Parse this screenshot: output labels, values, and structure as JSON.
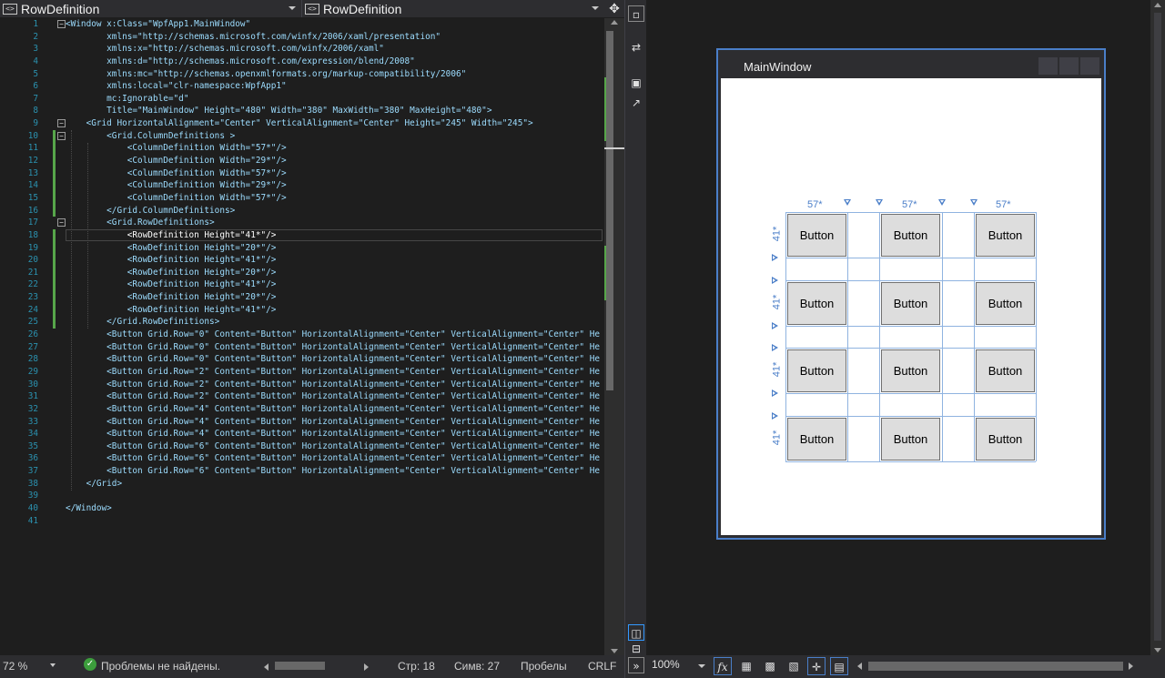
{
  "nav": {
    "left_combo": "RowDefinition",
    "right_combo": "RowDefinition",
    "split_icon": "split-vertical-icon"
  },
  "code_lines": [
    {
      "n": "1",
      "text": "<Window x:Class=\"WpfApp1.MainWindow\""
    },
    {
      "n": "2",
      "text": "        xmlns=\"http://schemas.microsoft.com/winfx/2006/xaml/presentation\""
    },
    {
      "n": "3",
      "text": "        xmlns:x=\"http://schemas.microsoft.com/winfx/2006/xaml\""
    },
    {
      "n": "4",
      "text": "        xmlns:d=\"http://schemas.microsoft.com/expression/blend/2008\""
    },
    {
      "n": "5",
      "text": "        xmlns:mc=\"http://schemas.openxmlformats.org/markup-compatibility/2006\""
    },
    {
      "n": "6",
      "text": "        xmlns:local=\"clr-namespace:WpfApp1\""
    },
    {
      "n": "7",
      "text": "        mc:Ignorable=\"d\""
    },
    {
      "n": "8",
      "text": "        Title=\"MainWindow\" Height=\"480\" Width=\"380\" MaxWidth=\"380\" MaxHeight=\"480\">"
    },
    {
      "n": "9",
      "text": "    <Grid HorizontalAlignment=\"Center\" VerticalAlignment=\"Center\" Height=\"245\" Width=\"245\">"
    },
    {
      "n": "10",
      "text": "        <Grid.ColumnDefinitions >"
    },
    {
      "n": "11",
      "text": "            <ColumnDefinition Width=\"57*\"/>"
    },
    {
      "n": "12",
      "text": "            <ColumnDefinition Width=\"29*\"/>"
    },
    {
      "n": "13",
      "text": "            <ColumnDefinition Width=\"57*\"/>"
    },
    {
      "n": "14",
      "text": "            <ColumnDefinition Width=\"29*\"/>"
    },
    {
      "n": "15",
      "text": "            <ColumnDefinition Width=\"57*\"/>"
    },
    {
      "n": "16",
      "text": "        </Grid.ColumnDefinitions>"
    },
    {
      "n": "17",
      "text": "        <Grid.RowDefinitions>"
    },
    {
      "n": "18",
      "text": "            <RowDefinition Height=\"41*\"/>"
    },
    {
      "n": "19",
      "text": "            <RowDefinition Height=\"20*\"/>"
    },
    {
      "n": "20",
      "text": "            <RowDefinition Height=\"41*\"/>"
    },
    {
      "n": "21",
      "text": "            <RowDefinition Height=\"20*\"/>"
    },
    {
      "n": "22",
      "text": "            <RowDefinition Height=\"41*\"/>"
    },
    {
      "n": "23",
      "text": "            <RowDefinition Height=\"20*\"/>"
    },
    {
      "n": "24",
      "text": "            <RowDefinition Height=\"41*\"/>"
    },
    {
      "n": "25",
      "text": "        </Grid.RowDefinitions>"
    },
    {
      "n": "26",
      "text": "        <Button Grid.Row=\"0\" Content=\"Button\" HorizontalAlignment=\"Center\" VerticalAlignment=\"Center\" He"
    },
    {
      "n": "27",
      "text": "        <Button Grid.Row=\"0\" Content=\"Button\" HorizontalAlignment=\"Center\" VerticalAlignment=\"Center\" He"
    },
    {
      "n": "28",
      "text": "        <Button Grid.Row=\"0\" Content=\"Button\" HorizontalAlignment=\"Center\" VerticalAlignment=\"Center\" He"
    },
    {
      "n": "29",
      "text": "        <Button Grid.Row=\"2\" Content=\"Button\" HorizontalAlignment=\"Center\" VerticalAlignment=\"Center\" He"
    },
    {
      "n": "30",
      "text": "        <Button Grid.Row=\"2\" Content=\"Button\" HorizontalAlignment=\"Center\" VerticalAlignment=\"Center\" He"
    },
    {
      "n": "31",
      "text": "        <Button Grid.Row=\"2\" Content=\"Button\" HorizontalAlignment=\"Center\" VerticalAlignment=\"Center\" He"
    },
    {
      "n": "32",
      "text": "        <Button Grid.Row=\"4\" Content=\"Button\" HorizontalAlignment=\"Center\" VerticalAlignment=\"Center\" He"
    },
    {
      "n": "33",
      "text": "        <Button Grid.Row=\"4\" Content=\"Button\" HorizontalAlignment=\"Center\" VerticalAlignment=\"Center\" He"
    },
    {
      "n": "34",
      "text": "        <Button Grid.Row=\"4\" Content=\"Button\" HorizontalAlignment=\"Center\" VerticalAlignment=\"Center\" He"
    },
    {
      "n": "35",
      "text": "        <Button Grid.Row=\"6\" Content=\"Button\" HorizontalAlignment=\"Center\" VerticalAlignment=\"Center\" He"
    },
    {
      "n": "36",
      "text": "        <Button Grid.Row=\"6\" Content=\"Button\" HorizontalAlignment=\"Center\" VerticalAlignment=\"Center\" He"
    },
    {
      "n": "37",
      "text": "        <Button Grid.Row=\"6\" Content=\"Button\" HorizontalAlignment=\"Center\" VerticalAlignment=\"Center\" He"
    },
    {
      "n": "38",
      "text": "    </Grid>"
    },
    {
      "n": "39",
      "text": ""
    },
    {
      "n": "40",
      "text": "</Window>"
    },
    {
      "n": "41",
      "text": ""
    }
  ],
  "editor_status": {
    "zoom": "72 %",
    "problems": "Проблемы не найдены.",
    "line": "Стр: 18",
    "col": "Симв: 27",
    "spaces": "Пробелы",
    "eol": "CRLF"
  },
  "designer": {
    "window_title": "MainWindow",
    "column_labels": [
      "57*",
      "57*",
      "57*"
    ],
    "row_labels": [
      "41*",
      "41*",
      "41*",
      "41*"
    ],
    "button_label": "Button",
    "zoom": "100%",
    "fx_label": "fx"
  },
  "colors": {
    "accent": "#4a7ec8",
    "line_number": "#2b91af",
    "change_bar": "#57a64a",
    "editor_bg": "#1e1e1e",
    "chrome_bg": "#2d2d30"
  }
}
